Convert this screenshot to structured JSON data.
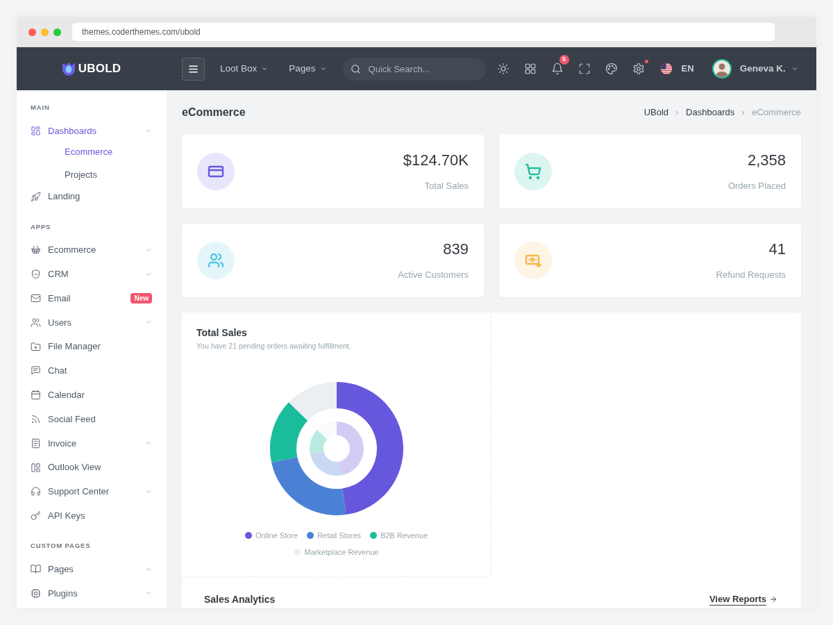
{
  "browser": {
    "url": "themes.coderthemes.com/ubold"
  },
  "topbar": {
    "logo": "UBOLD",
    "menus": [
      {
        "label": "Loot Box"
      },
      {
        "label": "Pages"
      }
    ],
    "search": {
      "placeholder": "Quick Search..."
    },
    "notifications": {
      "count": "5"
    },
    "settings_alert": true,
    "language": "EN",
    "user": {
      "name": "Geneva K."
    }
  },
  "sidebar": {
    "sections": [
      {
        "title": "MAIN",
        "items": [
          {
            "label": "Dashboards",
            "selected": true,
            "expanded": true,
            "children": [
              {
                "label": "Ecommerce",
                "selected": true
              },
              {
                "label": "Projects",
                "selected": false
              }
            ]
          },
          {
            "label": "Landing",
            "selected": false
          }
        ]
      },
      {
        "title": "APPS",
        "items": [
          {
            "label": "Ecommerce",
            "selected": false,
            "expanded": false
          },
          {
            "label": "CRM",
            "selected": false,
            "expanded": false
          },
          {
            "label": "Email",
            "selected": false,
            "badge": "New"
          },
          {
            "label": "Users",
            "selected": false,
            "expanded": false
          },
          {
            "label": "File Manager",
            "selected": false
          },
          {
            "label": "Chat",
            "selected": false
          },
          {
            "label": "Calendar",
            "selected": false
          },
          {
            "label": "Social Feed",
            "selected": false
          },
          {
            "label": "Invoice",
            "selected": false,
            "expanded": false
          },
          {
            "label": "Outlook View",
            "selected": false
          },
          {
            "label": "Support Center",
            "selected": false,
            "expanded": false
          },
          {
            "label": "API Keys",
            "selected": false
          }
        ]
      },
      {
        "title": "CUSTOM PAGES",
        "items": [
          {
            "label": "Pages",
            "selected": false,
            "expanded": false
          },
          {
            "label": "Plugins",
            "selected": false,
            "expanded": false
          }
        ]
      }
    ]
  },
  "page": {
    "title": "eCommerce",
    "breadcrumb": [
      {
        "label": "UBold",
        "current": false
      },
      {
        "label": "Dashboards",
        "current": false
      },
      {
        "label": "eCommerce",
        "current": true
      }
    ]
  },
  "stats": [
    {
      "value": "$124.70K",
      "label": "Total Sales",
      "color": "#6658dd"
    },
    {
      "value": "2,358",
      "label": "Orders Placed",
      "color": "#1abc9c"
    },
    {
      "value": "839",
      "label": "Active Customers",
      "color": "#4fc6e1"
    },
    {
      "value": "41",
      "label": "Refund Requests",
      "color": "#f7b84b"
    }
  ],
  "total_sales": {
    "title": "Total Sales",
    "subtitle": "You have 21 pending orders awaiting fulfillment.",
    "legend": [
      {
        "label": "Online Store",
        "color": "#6658dd"
      },
      {
        "label": "Retail Stores",
        "color": "#4a81d4"
      },
      {
        "label": "B2B Revenue",
        "color": "#1abc9c"
      },
      {
        "label": "Marketplace Revenue",
        "color": "#ebeff2"
      }
    ]
  },
  "sales_analytics": {
    "title": "Sales Analytics",
    "link": "View Reports"
  }
}
